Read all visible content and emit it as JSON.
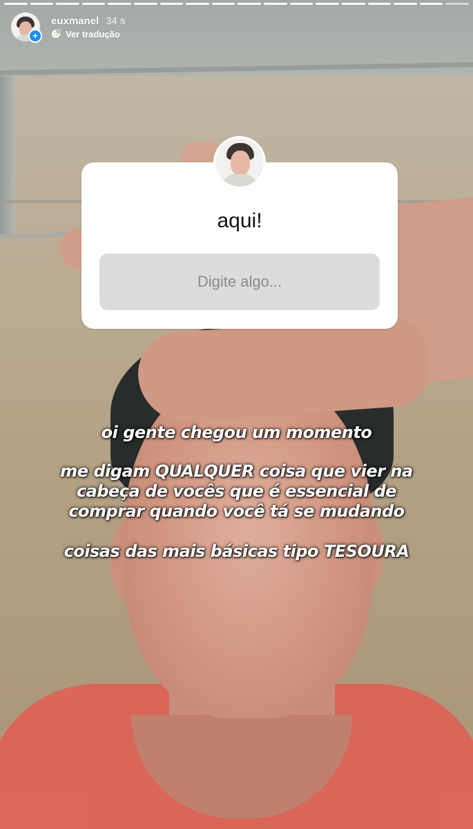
{
  "story": {
    "progress_segments": 18,
    "progress_current": 17
  },
  "header": {
    "username": "euxmanel",
    "time": "34 s",
    "translate_label": "Ver tradução",
    "avatar_icon": "profile-avatar",
    "badge_icon": "plus-icon",
    "badge_symbol": "+"
  },
  "question_sticker": {
    "question": "aqui!",
    "placeholder": "Digite algo..."
  },
  "caption": {
    "line1": "oi gente chegou um momento",
    "line2": "me digam QUALQUER coisa que vier na",
    "line3": "cabeça de vocês que é essencial de",
    "line4": "comprar quando você tá se mudando",
    "line5": "coisas das mais básicas tipo TESOURA"
  },
  "colors": {
    "badge": "#1a8cf0",
    "sticker_bg": "#ffffff",
    "input_bg": "#dcdcdc",
    "shirt": "#e36b5d"
  }
}
